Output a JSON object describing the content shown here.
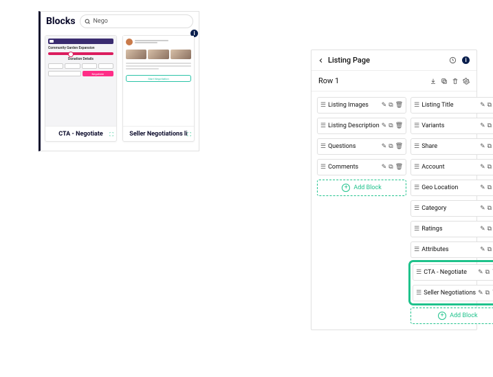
{
  "blocksPanel": {
    "title": "Blocks",
    "searchPlaceholder": "Nego",
    "cards": [
      {
        "title": "CTA - Negotiate"
      },
      {
        "title": "Seller Negotiations li"
      }
    ],
    "thumb1": {
      "label1": "Community Garden Expansion",
      "label2": "Donation Details",
      "btnNegotiate": "Negotiate"
    },
    "thumb2": {
      "btn": "Start Negotiation"
    }
  },
  "rightPanel": {
    "title": "Listing Page",
    "rowTitle": "Row 1",
    "col1": [
      "Listing Images",
      "Listing Description",
      "Questions",
      "Comments"
    ],
    "col2": [
      "Listing Title",
      "Variants",
      "Share",
      "Account",
      "Geo Location",
      "Category",
      "Ratings",
      "Attributes"
    ],
    "highlighted": [
      "CTA - Negotiate",
      "Seller Negotiations"
    ],
    "addBlock": "Add Block"
  }
}
